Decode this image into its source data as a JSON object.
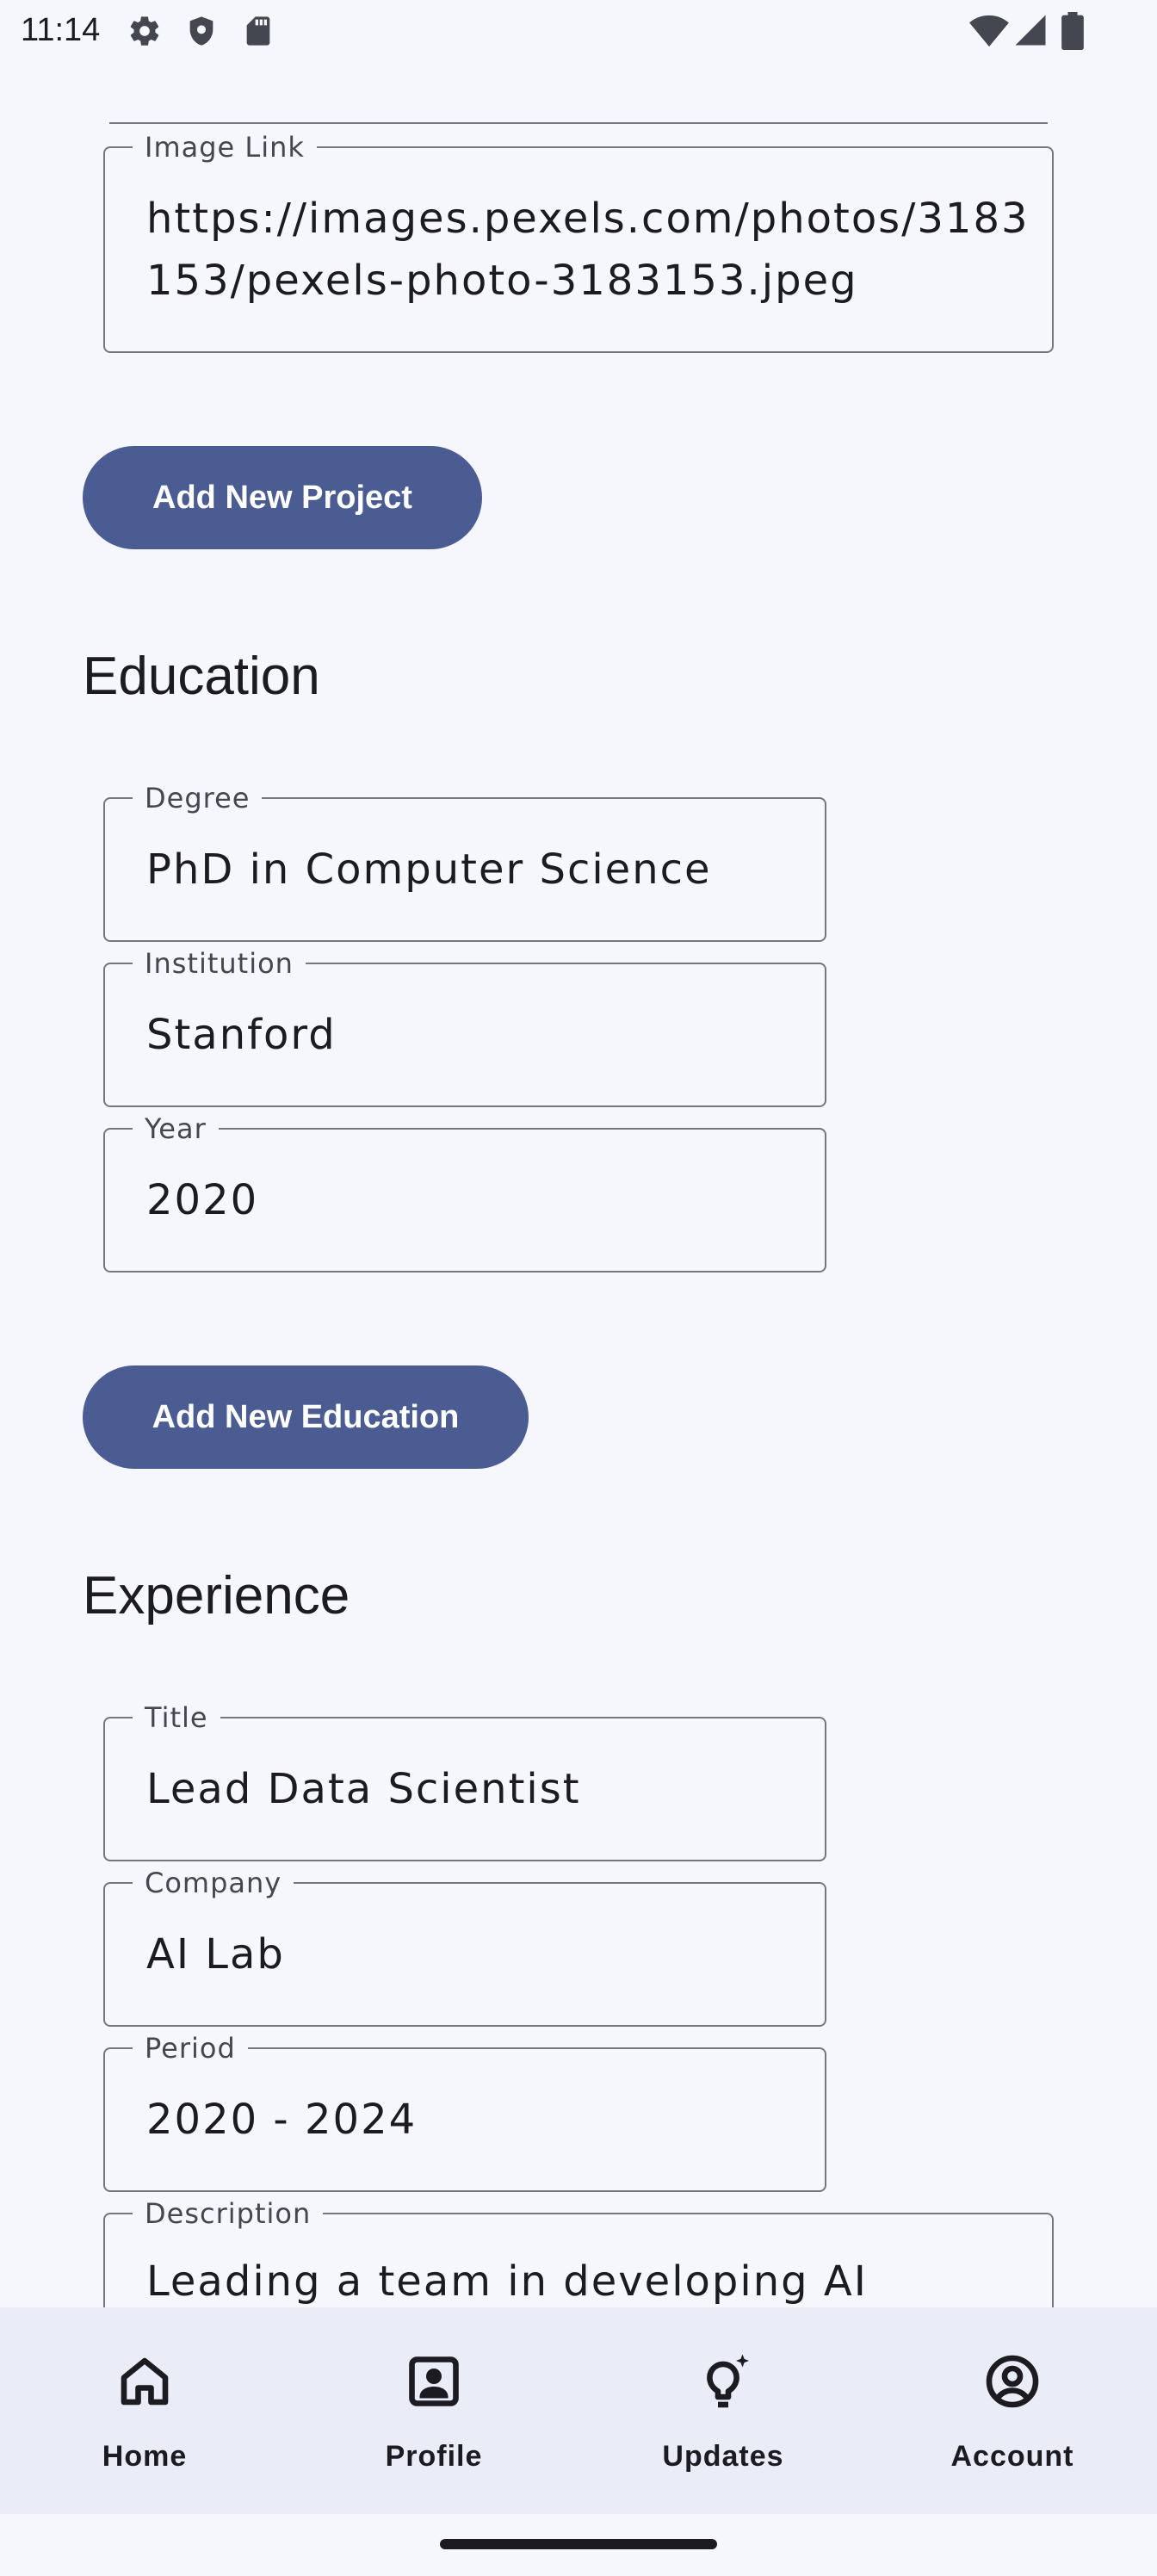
{
  "status_bar": {
    "time": "11:14",
    "icons": [
      "gear-icon",
      "shield-icon",
      "sd-card-icon",
      "wifi-icon",
      "signal-icon",
      "battery-icon"
    ]
  },
  "projects": {
    "image_link": {
      "label": "Image Link",
      "value": "https://images.pexels.com/photos/3183153/pexels-photo-3183153.jpeg"
    },
    "add_button": "Add New Project"
  },
  "education": {
    "title": "Education",
    "degree": {
      "label": "Degree",
      "value": "PhD in Computer Science"
    },
    "institution": {
      "label": "Institution",
      "value": "Stanford"
    },
    "year": {
      "label": "Year",
      "value": "2020"
    },
    "add_button": "Add New Education"
  },
  "experience": {
    "title": "Experience",
    "job_title": {
      "label": "Title",
      "value": "Lead Data Scientist"
    },
    "company": {
      "label": "Company",
      "value": "AI Lab"
    },
    "period": {
      "label": "Period",
      "value": "2020 - 2024"
    },
    "description": {
      "label": "Description",
      "value": "Leading a team in developing AI"
    }
  },
  "bottom_nav": {
    "items": [
      {
        "label": "Home",
        "icon": "home-icon"
      },
      {
        "label": "Profile",
        "icon": "profile-icon"
      },
      {
        "label": "Updates",
        "icon": "lightbulb-icon"
      },
      {
        "label": "Account",
        "icon": "account-icon"
      }
    ]
  },
  "colors": {
    "background": "#f6f7fd",
    "primary_button": "#4a5c92",
    "nav_background": "#eaedf7",
    "outline": "#75777f"
  }
}
